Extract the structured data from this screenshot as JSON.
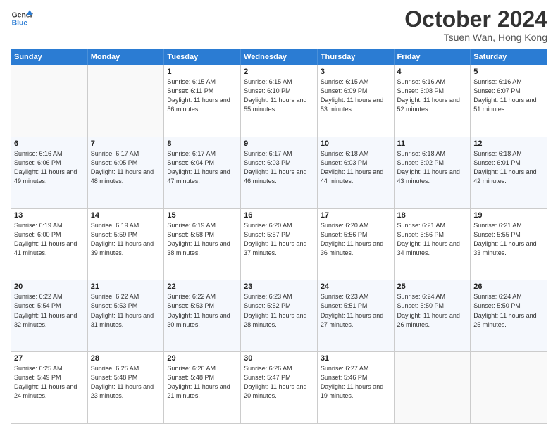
{
  "header": {
    "logo_line1": "General",
    "logo_line2": "Blue",
    "month": "October 2024",
    "location": "Tsuen Wan, Hong Kong"
  },
  "weekdays": [
    "Sunday",
    "Monday",
    "Tuesday",
    "Wednesday",
    "Thursday",
    "Friday",
    "Saturday"
  ],
  "weeks": [
    [
      {
        "day": "",
        "info": ""
      },
      {
        "day": "",
        "info": ""
      },
      {
        "day": "1",
        "info": "Sunrise: 6:15 AM\nSunset: 6:11 PM\nDaylight: 11 hours and 56 minutes."
      },
      {
        "day": "2",
        "info": "Sunrise: 6:15 AM\nSunset: 6:10 PM\nDaylight: 11 hours and 55 minutes."
      },
      {
        "day": "3",
        "info": "Sunrise: 6:15 AM\nSunset: 6:09 PM\nDaylight: 11 hours and 53 minutes."
      },
      {
        "day": "4",
        "info": "Sunrise: 6:16 AM\nSunset: 6:08 PM\nDaylight: 11 hours and 52 minutes."
      },
      {
        "day": "5",
        "info": "Sunrise: 6:16 AM\nSunset: 6:07 PM\nDaylight: 11 hours and 51 minutes."
      }
    ],
    [
      {
        "day": "6",
        "info": "Sunrise: 6:16 AM\nSunset: 6:06 PM\nDaylight: 11 hours and 49 minutes."
      },
      {
        "day": "7",
        "info": "Sunrise: 6:17 AM\nSunset: 6:05 PM\nDaylight: 11 hours and 48 minutes."
      },
      {
        "day": "8",
        "info": "Sunrise: 6:17 AM\nSunset: 6:04 PM\nDaylight: 11 hours and 47 minutes."
      },
      {
        "day": "9",
        "info": "Sunrise: 6:17 AM\nSunset: 6:03 PM\nDaylight: 11 hours and 46 minutes."
      },
      {
        "day": "10",
        "info": "Sunrise: 6:18 AM\nSunset: 6:03 PM\nDaylight: 11 hours and 44 minutes."
      },
      {
        "day": "11",
        "info": "Sunrise: 6:18 AM\nSunset: 6:02 PM\nDaylight: 11 hours and 43 minutes."
      },
      {
        "day": "12",
        "info": "Sunrise: 6:18 AM\nSunset: 6:01 PM\nDaylight: 11 hours and 42 minutes."
      }
    ],
    [
      {
        "day": "13",
        "info": "Sunrise: 6:19 AM\nSunset: 6:00 PM\nDaylight: 11 hours and 41 minutes."
      },
      {
        "day": "14",
        "info": "Sunrise: 6:19 AM\nSunset: 5:59 PM\nDaylight: 11 hours and 39 minutes."
      },
      {
        "day": "15",
        "info": "Sunrise: 6:19 AM\nSunset: 5:58 PM\nDaylight: 11 hours and 38 minutes."
      },
      {
        "day": "16",
        "info": "Sunrise: 6:20 AM\nSunset: 5:57 PM\nDaylight: 11 hours and 37 minutes."
      },
      {
        "day": "17",
        "info": "Sunrise: 6:20 AM\nSunset: 5:56 PM\nDaylight: 11 hours and 36 minutes."
      },
      {
        "day": "18",
        "info": "Sunrise: 6:21 AM\nSunset: 5:56 PM\nDaylight: 11 hours and 34 minutes."
      },
      {
        "day": "19",
        "info": "Sunrise: 6:21 AM\nSunset: 5:55 PM\nDaylight: 11 hours and 33 minutes."
      }
    ],
    [
      {
        "day": "20",
        "info": "Sunrise: 6:22 AM\nSunset: 5:54 PM\nDaylight: 11 hours and 32 minutes."
      },
      {
        "day": "21",
        "info": "Sunrise: 6:22 AM\nSunset: 5:53 PM\nDaylight: 11 hours and 31 minutes."
      },
      {
        "day": "22",
        "info": "Sunrise: 6:22 AM\nSunset: 5:53 PM\nDaylight: 11 hours and 30 minutes."
      },
      {
        "day": "23",
        "info": "Sunrise: 6:23 AM\nSunset: 5:52 PM\nDaylight: 11 hours and 28 minutes."
      },
      {
        "day": "24",
        "info": "Sunrise: 6:23 AM\nSunset: 5:51 PM\nDaylight: 11 hours and 27 minutes."
      },
      {
        "day": "25",
        "info": "Sunrise: 6:24 AM\nSunset: 5:50 PM\nDaylight: 11 hours and 26 minutes."
      },
      {
        "day": "26",
        "info": "Sunrise: 6:24 AM\nSunset: 5:50 PM\nDaylight: 11 hours and 25 minutes."
      }
    ],
    [
      {
        "day": "27",
        "info": "Sunrise: 6:25 AM\nSunset: 5:49 PM\nDaylight: 11 hours and 24 minutes."
      },
      {
        "day": "28",
        "info": "Sunrise: 6:25 AM\nSunset: 5:48 PM\nDaylight: 11 hours and 23 minutes."
      },
      {
        "day": "29",
        "info": "Sunrise: 6:26 AM\nSunset: 5:48 PM\nDaylight: 11 hours and 21 minutes."
      },
      {
        "day": "30",
        "info": "Sunrise: 6:26 AM\nSunset: 5:47 PM\nDaylight: 11 hours and 20 minutes."
      },
      {
        "day": "31",
        "info": "Sunrise: 6:27 AM\nSunset: 5:46 PM\nDaylight: 11 hours and 19 minutes."
      },
      {
        "day": "",
        "info": ""
      },
      {
        "day": "",
        "info": ""
      }
    ]
  ]
}
